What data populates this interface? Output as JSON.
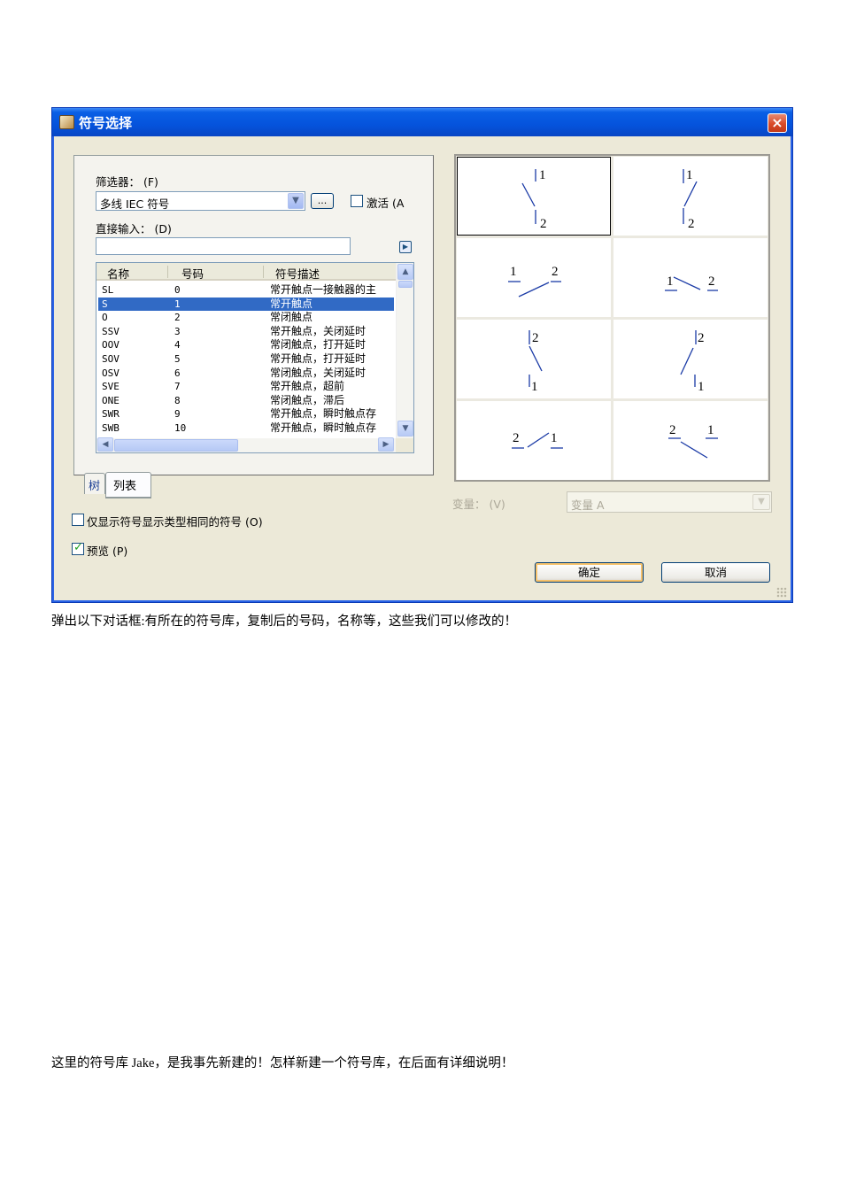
{
  "dialog": {
    "title": "符号选择",
    "close_label": "×",
    "filter_label": "筛选器： (F)",
    "filter_value": "多线 IEC 符号",
    "browse_label": "...",
    "activate_label": "激活 (A",
    "direct_input_label": "直接输入： (D)",
    "direct_input_value": "",
    "list": {
      "columns": [
        "名称",
        "号码",
        "符号描述"
      ],
      "rows": [
        {
          "name": "SL",
          "number": "0",
          "desc": "常开触点一接触器的主"
        },
        {
          "name": "S",
          "number": "1",
          "desc": "常开触点",
          "selected": true
        },
        {
          "name": "O",
          "number": "2",
          "desc": "常闭触点"
        },
        {
          "name": "SSV",
          "number": "3",
          "desc": "常开触点，关闭延时"
        },
        {
          "name": "OOV",
          "number": "4",
          "desc": "常闭触点，打开延时"
        },
        {
          "name": "SOV",
          "number": "5",
          "desc": "常开触点，打开延时"
        },
        {
          "name": "OSV",
          "number": "6",
          "desc": "常闭触点，关闭延时"
        },
        {
          "name": "SVE",
          "number": "7",
          "desc": "常开触点，超前"
        },
        {
          "name": "ONE",
          "number": "8",
          "desc": "常闭触点，滞后"
        },
        {
          "name": "SWR",
          "number": "9",
          "desc": "常开触点，瞬时触点存"
        },
        {
          "name": "SWB",
          "number": "10",
          "desc": "常开触点，瞬时触点存"
        }
      ]
    },
    "tabs": [
      "树",
      "列表"
    ],
    "only_same_type_label": "仅显示符号显示类型相同的符号 (O)",
    "only_same_type_checked": false,
    "preview_label": "预览 (P)",
    "preview_checked": true,
    "variant_label": "变量： (V)",
    "variant_value": "变量 A",
    "ok_label": "确定",
    "cancel_label": "取消",
    "symbols": [
      {
        "top": "1",
        "bottom": "2"
      },
      {
        "top": "1",
        "bottom": "2"
      },
      {
        "left": "1",
        "right": "2"
      },
      {
        "left": "1",
        "right": "2"
      },
      {
        "top": "2",
        "bottom": "1"
      },
      {
        "top": "2",
        "bottom": "1"
      },
      {
        "left": "2",
        "right": "1"
      },
      {
        "left": "2",
        "right": "1"
      }
    ]
  },
  "captions": {
    "caption_1": "弹出以下对话框:有所在的符号库，复制后的号码，名称等，这些我们可以修改的！",
    "caption_2": "这里的符号库 Jake，是我事先新建的！怎样新建一个符号库，在后面有详细说明！"
  },
  "colors": {
    "titlebar": "#0553dc",
    "selection": "#316ac5",
    "dialog_bg": "#ece9d8",
    "symbol_stroke": "#1a3aa6"
  }
}
